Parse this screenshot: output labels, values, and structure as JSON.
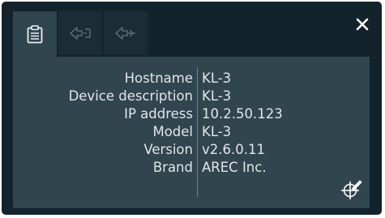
{
  "tabs": [
    {
      "icon": "device-info-icon",
      "active": true
    },
    {
      "icon": "network-in-icon",
      "active": false
    },
    {
      "icon": "network-out-icon",
      "active": false
    }
  ],
  "close_icon": "close-icon",
  "edit_icon": "crosshair-pen-icon",
  "info": {
    "rows": [
      {
        "label": "Hostname",
        "value": "KL-3"
      },
      {
        "label": "Device description",
        "value": "KL-3"
      },
      {
        "label": "IP address",
        "value": "10.2.50.123"
      },
      {
        "label": "Model",
        "value": "KL-3"
      },
      {
        "label": "Version",
        "value": "v2.6.0.11"
      },
      {
        "label": "Brand",
        "value": "AREC Inc."
      }
    ]
  },
  "colors": {
    "background": "#13232c",
    "panel": "#31454f",
    "text": "#e2e6e8"
  }
}
